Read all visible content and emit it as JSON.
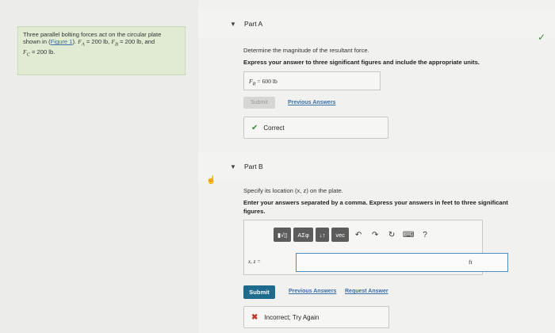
{
  "problem": {
    "text_before_link": "Three parallel bolting forces act on the circular plate shown in (",
    "link": "Figure 1",
    "text_after_link": "). ",
    "fa": "F",
    "fa_sub": "A",
    "fa_val": " = 200 lb",
    "fb": "F",
    "fb_sub": "B",
    "fb_val": " = 200 lb",
    "and": ", and",
    "fc": "F",
    "fc_sub": "C",
    "fc_val": " = 200 lb."
  },
  "part_a": {
    "title": "Part A",
    "prompt": "Determine the magnitude of the resultant force.",
    "instruction": "Express your answer to three significant figures and include the appropriate units.",
    "answer_label": "F",
    "answer_sub": "R",
    "answer_value": " =  600 lb",
    "submit_label": "Submit",
    "previous_answers": "Previous Answers",
    "feedback": "Correct"
  },
  "part_b": {
    "title": "Part B",
    "prompt": "Specify its location (x, z) on the plate.",
    "instruction_line1": "Enter your answers separated by a comma. Express your answers in feet to three significant",
    "instruction_line2": "figures.",
    "toolbar": {
      "greek": "ΑΣφ",
      "arrows": "↓↑",
      "vec": "vec",
      "help": "?"
    },
    "eq_label": "x, z =",
    "unit": "ft",
    "submit_label": "Submit",
    "previous_answers": "Previous Answers",
    "request_answer": "Request Answer",
    "feedback": "Incorrect; Try Again"
  },
  "colors": {
    "correct": "#3f8a3a",
    "incorrect": "#c23a2b",
    "submit": "#1f6b8e",
    "link": "#3a6ea5"
  }
}
